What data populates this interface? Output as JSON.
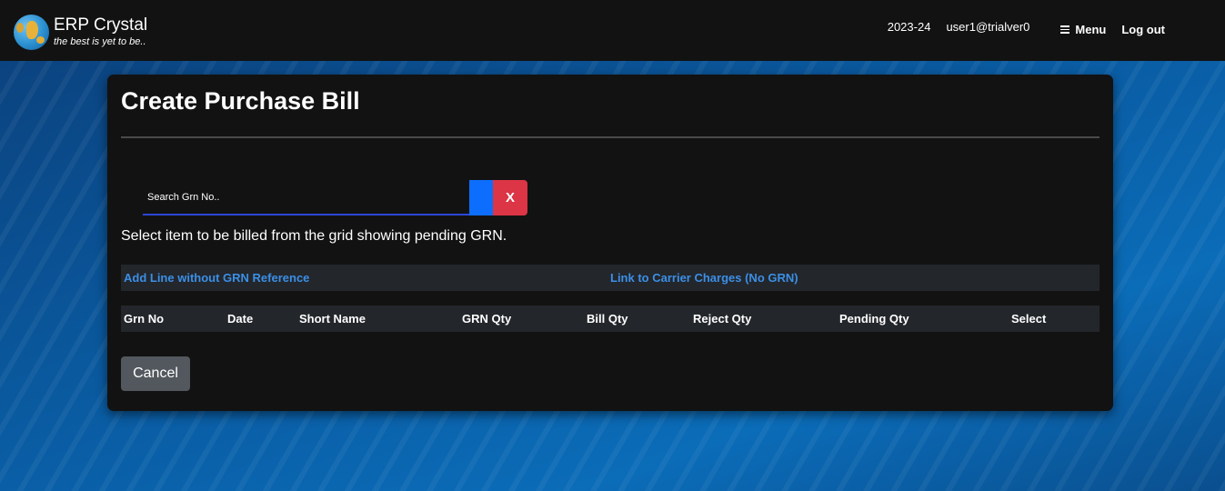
{
  "app": {
    "name": "ERP Crystal",
    "tagline": "the best is yet to be.."
  },
  "nav": {
    "year": "2023-24",
    "user": "user1@trialver0",
    "menu_label": "Menu",
    "logout_label": "Log out"
  },
  "page": {
    "title": "Create Purchase Bill",
    "search_placeholder": "Search Grn No..",
    "clear_label": "X",
    "help_text": "Select item to be billed from the grid showing pending GRN.",
    "links": {
      "add_line": "Add Line without GRN Reference",
      "carrier": "Link to Carrier Charges (No GRN)"
    },
    "table": {
      "columns": [
        "Grn No",
        "Date",
        "Short Name",
        "GRN Qty",
        "Bill Qty",
        "Reject Qty",
        "Pending Qty",
        "Select"
      ],
      "rows": []
    },
    "cancel_label": "Cancel"
  },
  "colors": {
    "navbar": "#121212",
    "card": "#121212",
    "link": "#3b8fe6",
    "primary": "#0d6efd",
    "danger": "#dc3545",
    "secondary": "#53585e"
  }
}
